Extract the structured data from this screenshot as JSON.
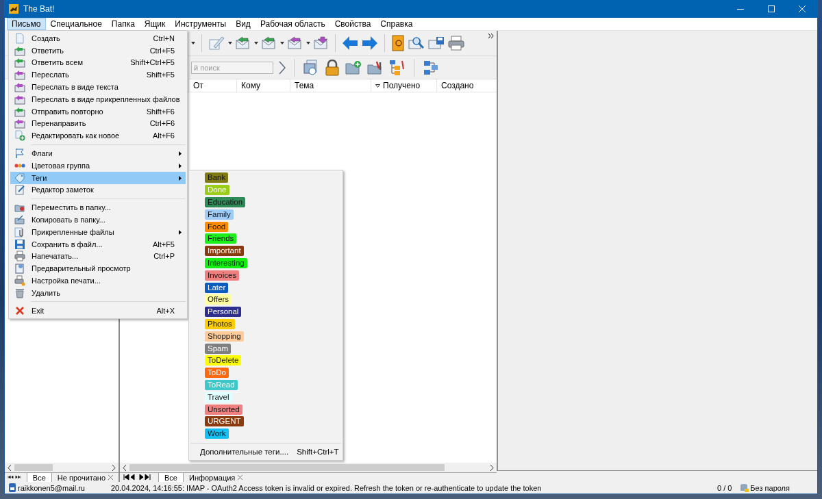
{
  "window": {
    "title": "The Bat!"
  },
  "menu_bar": [
    {
      "label": "Письмо",
      "selected": true
    },
    {
      "label": "Специальное",
      "selected": false
    },
    {
      "label": "Папка",
      "selected": false
    },
    {
      "label": "Ящик",
      "selected": false
    },
    {
      "label": "Инструменты",
      "selected": false
    },
    {
      "label": "Вид",
      "selected": false
    },
    {
      "label": "Рабочая область",
      "selected": false
    },
    {
      "label": "Свойства",
      "selected": false
    },
    {
      "label": "Справка",
      "selected": false
    }
  ],
  "search": {
    "placeholder": "й поиск"
  },
  "columns": [
    {
      "label": "От",
      "sorted": false
    },
    {
      "label": "Кому",
      "sorted": false
    },
    {
      "label": "Тема",
      "sorted": false
    },
    {
      "label": "Получено",
      "sorted": true
    },
    {
      "label": "Создано",
      "sorted": false
    }
  ],
  "menu": {
    "items": [
      {
        "kind": "item",
        "label": "Создать",
        "shortcut": "Ctrl+N",
        "submenu": false,
        "selected": false
      },
      {
        "kind": "item",
        "label": "Ответить",
        "shortcut": "Ctrl+F5",
        "submenu": false,
        "selected": false
      },
      {
        "kind": "item",
        "label": "Ответить всем",
        "shortcut": "Shift+Ctrl+F5",
        "submenu": false,
        "selected": false
      },
      {
        "kind": "item",
        "label": "Переслать",
        "shortcut": "Shift+F5",
        "submenu": false,
        "selected": false
      },
      {
        "kind": "item",
        "label": "Переслать в виде текста",
        "submenu": false,
        "selected": false
      },
      {
        "kind": "item",
        "label": "Переслать в виде прикрепленных файлов",
        "submenu": false,
        "selected": false
      },
      {
        "kind": "item",
        "label": "Отправить повторно",
        "shortcut": "Shift+F6",
        "submenu": false,
        "selected": false
      },
      {
        "kind": "item",
        "label": "Перенаправить",
        "shortcut": "Ctrl+F6",
        "submenu": false,
        "selected": false
      },
      {
        "kind": "item",
        "label": "Редактировать как новое",
        "shortcut": "Alt+F6",
        "submenu": false,
        "selected": false
      },
      {
        "kind": "separator"
      },
      {
        "kind": "item",
        "label": "Флаги",
        "submenu": true,
        "selected": false
      },
      {
        "kind": "item",
        "label": "Цветовая группа",
        "submenu": true,
        "selected": false
      },
      {
        "kind": "item",
        "label": "Теги",
        "submenu": true,
        "selected": true
      },
      {
        "kind": "item",
        "label": "Редактор заметок",
        "submenu": false,
        "selected": false
      },
      {
        "kind": "separator"
      },
      {
        "kind": "item",
        "label": "Переместить в папку...",
        "submenu": false,
        "selected": false
      },
      {
        "kind": "item",
        "label": "Копировать в папку...",
        "submenu": false,
        "selected": false
      },
      {
        "kind": "item",
        "label": "Прикрепленные файлы",
        "submenu": true,
        "selected": false
      },
      {
        "kind": "item",
        "label": "Сохранить в файл...",
        "shortcut": "Alt+F5",
        "submenu": false,
        "selected": false
      },
      {
        "kind": "item",
        "label": "Напечатать...",
        "shortcut": "Ctrl+P",
        "submenu": false,
        "selected": false
      },
      {
        "kind": "item",
        "label": "Предварительный просмотр",
        "submenu": false,
        "selected": false
      },
      {
        "kind": "item",
        "label": "Настройка печати...",
        "submenu": false,
        "selected": false
      },
      {
        "kind": "item",
        "label": "Удалить",
        "submenu": false,
        "selected": false
      },
      {
        "kind": "separator"
      },
      {
        "kind": "item",
        "label": "Exit",
        "shortcut": "Alt+X",
        "submenu": false,
        "selected": false
      }
    ]
  },
  "tags_submenu": {
    "tags": [
      {
        "label": "Bank",
        "color": "#7f7a12",
        "light_text": false
      },
      {
        "label": "Done",
        "color": "#9acd1a",
        "light_text": true
      },
      {
        "label": "Education",
        "color": "#2e8b57",
        "light_text": false
      },
      {
        "label": "Family",
        "color": "#9fcbf7",
        "light_text": false
      },
      {
        "label": "Food",
        "color": "#ff8c00",
        "light_text": false
      },
      {
        "label": "Friends",
        "color": "#1bf01b",
        "light_text": false
      },
      {
        "label": "Important",
        "color": "#8b3a0f",
        "light_text": true
      },
      {
        "label": "Interesting",
        "color": "#13ee13",
        "light_text": false
      },
      {
        "label": "Invoices",
        "color": "#f08080",
        "light_text": false
      },
      {
        "label": "Later",
        "color": "#0c5cbf",
        "light_text": true
      },
      {
        "label": "Offers",
        "color": "#ffff9e",
        "light_text": false
      },
      {
        "label": "Personal",
        "color": "#2e2e8f",
        "light_text": true
      },
      {
        "label": "Photos",
        "color": "#ffcc00",
        "light_text": false
      },
      {
        "label": "Shopping",
        "color": "#ffcc99",
        "light_text": false
      },
      {
        "label": "Spam",
        "color": "#808080",
        "light_text": true
      },
      {
        "label": "ToDelete",
        "color": "#ffff00",
        "light_text": false
      },
      {
        "label": "ToDo",
        "color": "#ff6a10",
        "light_text": true
      },
      {
        "label": "ToRead",
        "color": "#3cc8c8",
        "light_text": true
      },
      {
        "label": "Travel",
        "color": "#e0ffff",
        "light_text": false
      },
      {
        "label": "Unsorted",
        "color": "#f08080",
        "light_text": false
      },
      {
        "label": "URGENT",
        "color": "#8b3a0f",
        "light_text": true
      },
      {
        "label": "Work",
        "color": "#14bff5",
        "light_text": false
      }
    ],
    "more": {
      "label": "Дополнительные теги....",
      "shortcut": "Shift+Ctrl+T"
    }
  },
  "left_tabs": [
    {
      "label": "Все",
      "selected": true,
      "closable": false
    },
    {
      "label": "Не прочитано",
      "selected": false,
      "closable": true
    }
  ],
  "middle_tabs": [
    {
      "label": "Все",
      "selected": true,
      "closable": false
    },
    {
      "label": "Информация",
      "selected": false,
      "closable": true
    }
  ],
  "status_bar": {
    "account": "raikkonen5@mail.ru",
    "message": "20.04.2024, 14:16:55: IMAP  - OAuth2 Access token is invalid or expired. Refresh the token or re-authenticate to update the token",
    "counter": "0 / 0",
    "password": "Без пароля"
  }
}
